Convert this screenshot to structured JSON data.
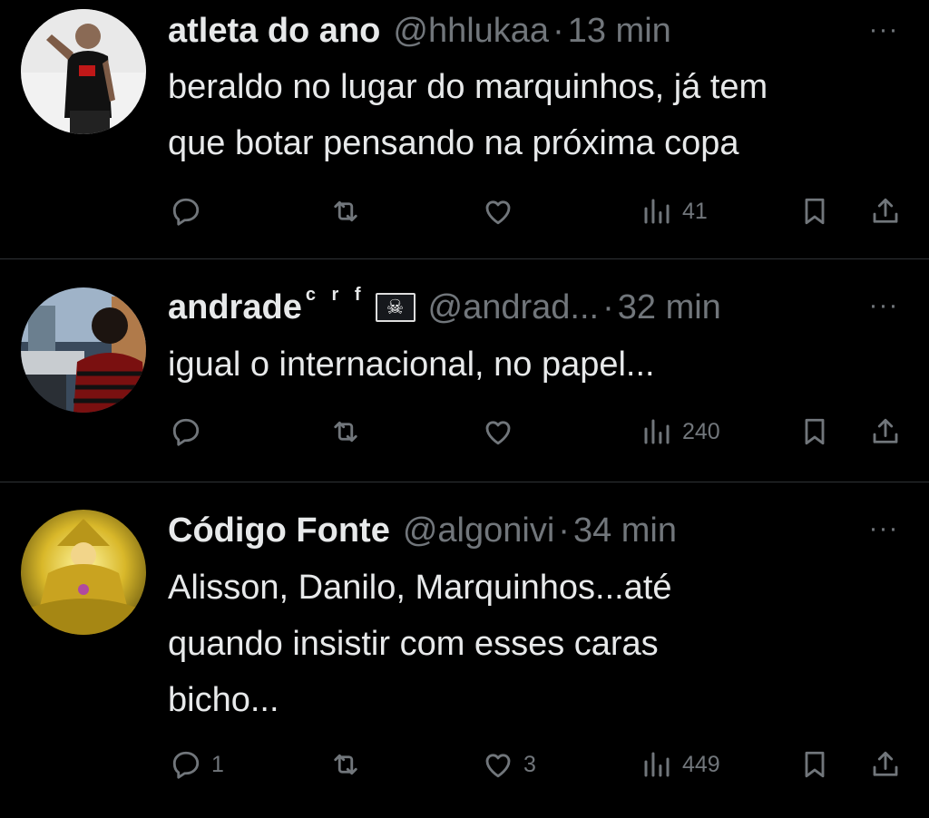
{
  "tweets": [
    {
      "name": "atleta do ano",
      "name_suffix": "",
      "flag": "",
      "handle": "@hhlukaa",
      "separator": "·",
      "time": "13 min",
      "more": "···",
      "lines": [
        "beraldo no lugar do marquinhos, já tem",
        "que botar pensando na próxima copa"
      ],
      "replies": "",
      "likes": "",
      "views": "41"
    },
    {
      "name": "andrade",
      "name_suffix": "c r f",
      "flag": "☠",
      "handle": "@andrad...",
      "separator": "·",
      "time": "32 min",
      "more": "···",
      "lines": [
        "igual o internacional, no papel..."
      ],
      "replies": "",
      "likes": "",
      "views": "240"
    },
    {
      "name": "Código Fonte",
      "name_suffix": "",
      "flag": "",
      "handle": "@algonivi",
      "separator": "·",
      "time": "34 min",
      "more": "···",
      "lines": [
        "Alisson, Danilo, Marquinhos...até",
        "quando insistir com esses caras",
        "bicho..."
      ],
      "replies": "1",
      "likes": "3",
      "views": "449"
    }
  ],
  "icons": {
    "reply": "reply-icon",
    "retweet": "retweet-icon",
    "like": "heart-icon",
    "views": "views-icon",
    "bookmark": "bookmark-icon",
    "share": "share-icon"
  },
  "colors": {
    "background": "#000000",
    "text": "#e7e9ea",
    "secondary": "#71767b",
    "divider": "#2f3336"
  }
}
